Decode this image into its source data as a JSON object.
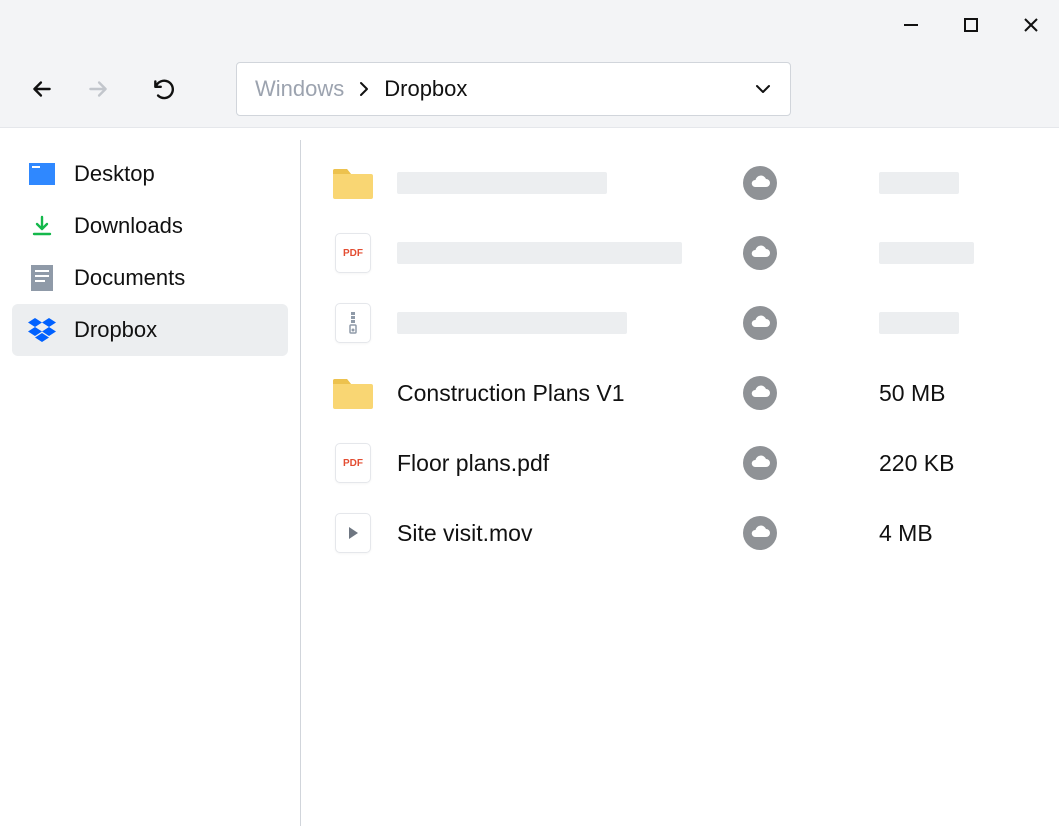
{
  "breadcrumb": {
    "parent": "Windows",
    "current": "Dropbox"
  },
  "sidebar": {
    "items": [
      {
        "label": "Desktop"
      },
      {
        "label": "Downloads"
      },
      {
        "label": "Documents"
      },
      {
        "label": "Dropbox"
      }
    ]
  },
  "icons": {
    "pdf_label": "PDF"
  },
  "files": {
    "row3": {
      "name": "Construction Plans V1",
      "size": "50 MB"
    },
    "row4": {
      "name": "Floor plans.pdf",
      "size": "220 KB"
    },
    "row5": {
      "name": "Site visit.mov",
      "size": "4 MB"
    }
  }
}
